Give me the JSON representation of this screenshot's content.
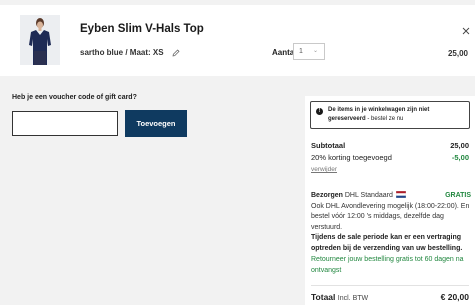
{
  "cart_item": {
    "title": "Eyben Slim V-Hals Top",
    "variant": "sartho blue / Maat: XS",
    "qty_label": "Aantal",
    "qty_value": "1",
    "price": "25,00"
  },
  "voucher": {
    "label": "Heb je een voucher code of gift card?",
    "input_value": "",
    "button_label": "Toevoegen"
  },
  "summary": {
    "notice_bold": "De items in je winkelwagen zijn niet gereserveerd",
    "notice_rest": " - bestel ze nu",
    "subtotal_label": "Subtotaal",
    "subtotal_value": "25,00",
    "discount_label": "20% korting toegevoegd",
    "discount_value": "-5,00",
    "remove_link": "verwijder",
    "shipping_label": "Bezorgen",
    "shipping_method": "DHL Standaard",
    "shipping_value": "GRATIS",
    "shipping_info": "Ook DHL Avondlevering mogelijk (18:00-22:00). En bestel vóór 12:00 's middags, dezelfde dag verstuurd.",
    "sale_warning": "Tijdens de sale periode kan er een vertraging optreden bij de verzending van uw bestelling.",
    "returns_text": "Retourneer jouw bestelling gratis tot 60 dagen na ontvangst",
    "total_label": "Totaal",
    "total_incl": "Incl. BTW",
    "total_value": "€ 20,00"
  },
  "colors": {
    "button_bg": "#0f3a60",
    "green": "#21873f"
  }
}
